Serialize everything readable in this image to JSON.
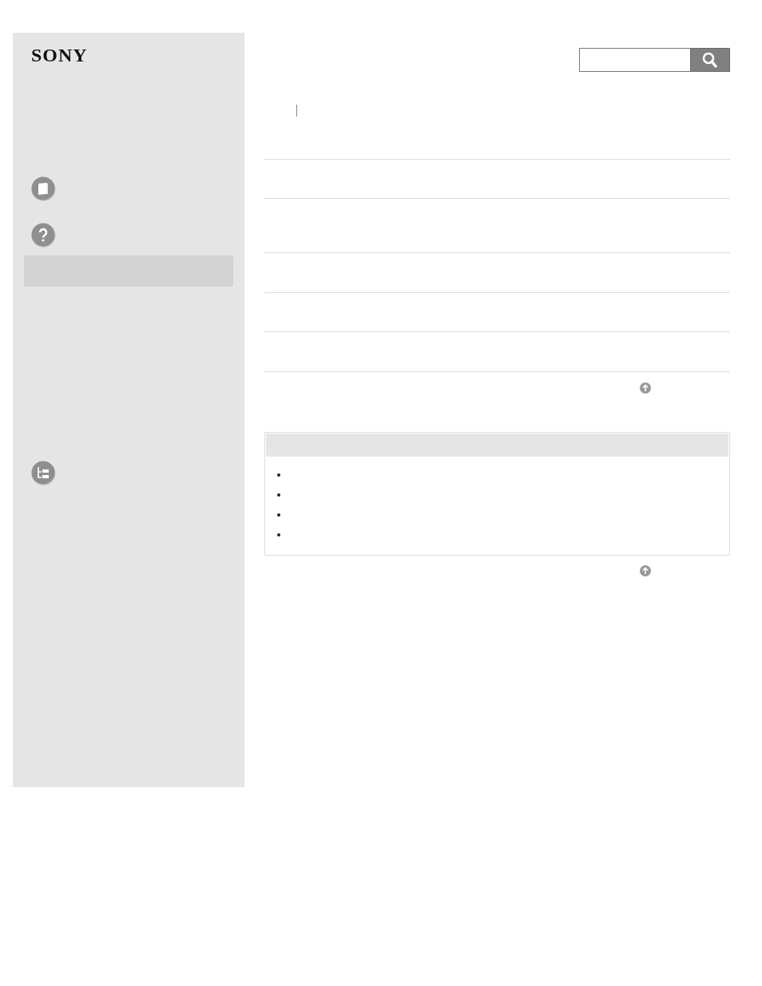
{
  "logo": "SONY",
  "sidebar": {
    "items": [
      {
        "kind": "book"
      },
      {
        "kind": "help"
      },
      {
        "kind": "highlight"
      },
      {
        "kind": "sitemap"
      }
    ]
  },
  "main": {
    "blocks": [
      {
        "kind": "top-link"
      },
      {
        "kind": "note",
        "bullets": [
          {
            "kind": "bullet"
          },
          {
            "kind": "bullet"
          },
          {
            "kind": "bullet"
          },
          {
            "kind": "bullet"
          }
        ]
      },
      {
        "kind": "top-link"
      }
    ]
  }
}
